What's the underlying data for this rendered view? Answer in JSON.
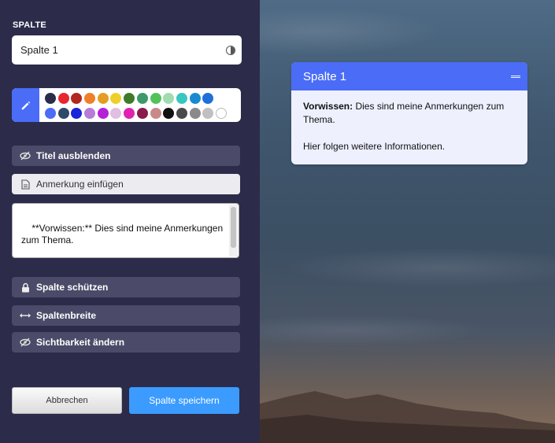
{
  "panel": {
    "section_label": "SPALTE",
    "title_value": "Spalte 1",
    "palette": {
      "colors_row1": [
        "#2a2c4a",
        "#e8262f",
        "#b2271f",
        "#f07f2a",
        "#e39d22",
        "#efcf2c",
        "#3f7a2a",
        "#3c9a6a",
        "#53c15a",
        "#9fdcae",
        "#39c6c1",
        "#1a8ad0",
        "#1f6fd8"
      ],
      "colors_row2": [
        "#4a6cf7",
        "#2e4a6a",
        "#1a24d8",
        "#b77bd8",
        "#b422d8",
        "#e0bfe0",
        "#e022b0",
        "#8a1a4a",
        "#c98a8a",
        "#111111",
        "#4a4a4a",
        "#8a8a8a",
        "#c0c0c0",
        "#ffffff"
      ]
    },
    "options": {
      "hide_title": "Titel ausblenden",
      "add_note": "Anmerkung einfügen",
      "protect": "Spalte schützen",
      "width": "Spaltenbreite",
      "visibility": "Sichtbarkeit ändern"
    },
    "note_text": "**Vorwissen:** Dies sind meine Anmerkungen zum Thema.\n\nHier folgen weitere Informationen.",
    "cancel_label": "Abbrechen",
    "save_label": "Spalte speichern"
  },
  "card": {
    "title": "Spalte 1",
    "bold_prefix": "Vorwissen:",
    "line1": " Dies sind meine Anmerkungen zum Thema.",
    "line2": "Hier folgen weitere Informationen."
  },
  "colors": {
    "accent": "#4a6cf7",
    "panel_bg": "#2c2b4a",
    "save": "#3b9bff"
  }
}
